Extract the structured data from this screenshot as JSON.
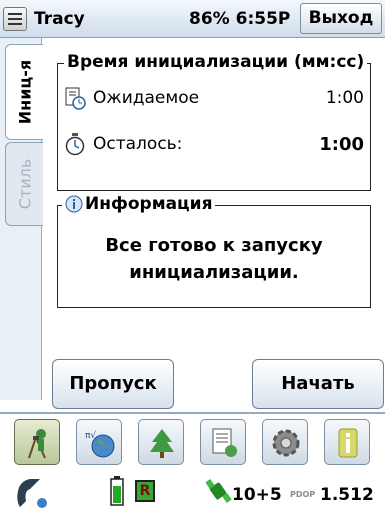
{
  "titlebar": {
    "user": "Tracy",
    "battery_time": "86% 6:55P",
    "exit_label": "Выход"
  },
  "tabs": [
    {
      "label": "Иниц-я",
      "active": true
    },
    {
      "label": "Стиль",
      "active": false
    }
  ],
  "init_group": {
    "legend": "Время инициализации (мм:сс)",
    "expected_label": "Ожидаемое",
    "expected_value": "1:00",
    "remaining_label": "Осталось:",
    "remaining_value": "1:00"
  },
  "info_group": {
    "legend": "Информация",
    "line1": "Все готово к запуску",
    "line2": "инициализации."
  },
  "buttons": {
    "skip": "Пропуск",
    "start": "Начать"
  },
  "app_bar": [
    "survey-icon",
    "globe-icon",
    "tree-icon",
    "notes-icon",
    "gear-icon",
    "info-icon"
  ],
  "status": {
    "receiver_badge": "R",
    "satellites": "10+5",
    "pdop_label": "PDOP",
    "pdop_value": "1.512"
  },
  "colors": {
    "accent": "#2f72c0",
    "panel": "#e8eff6",
    "battery": "#22aa22"
  }
}
